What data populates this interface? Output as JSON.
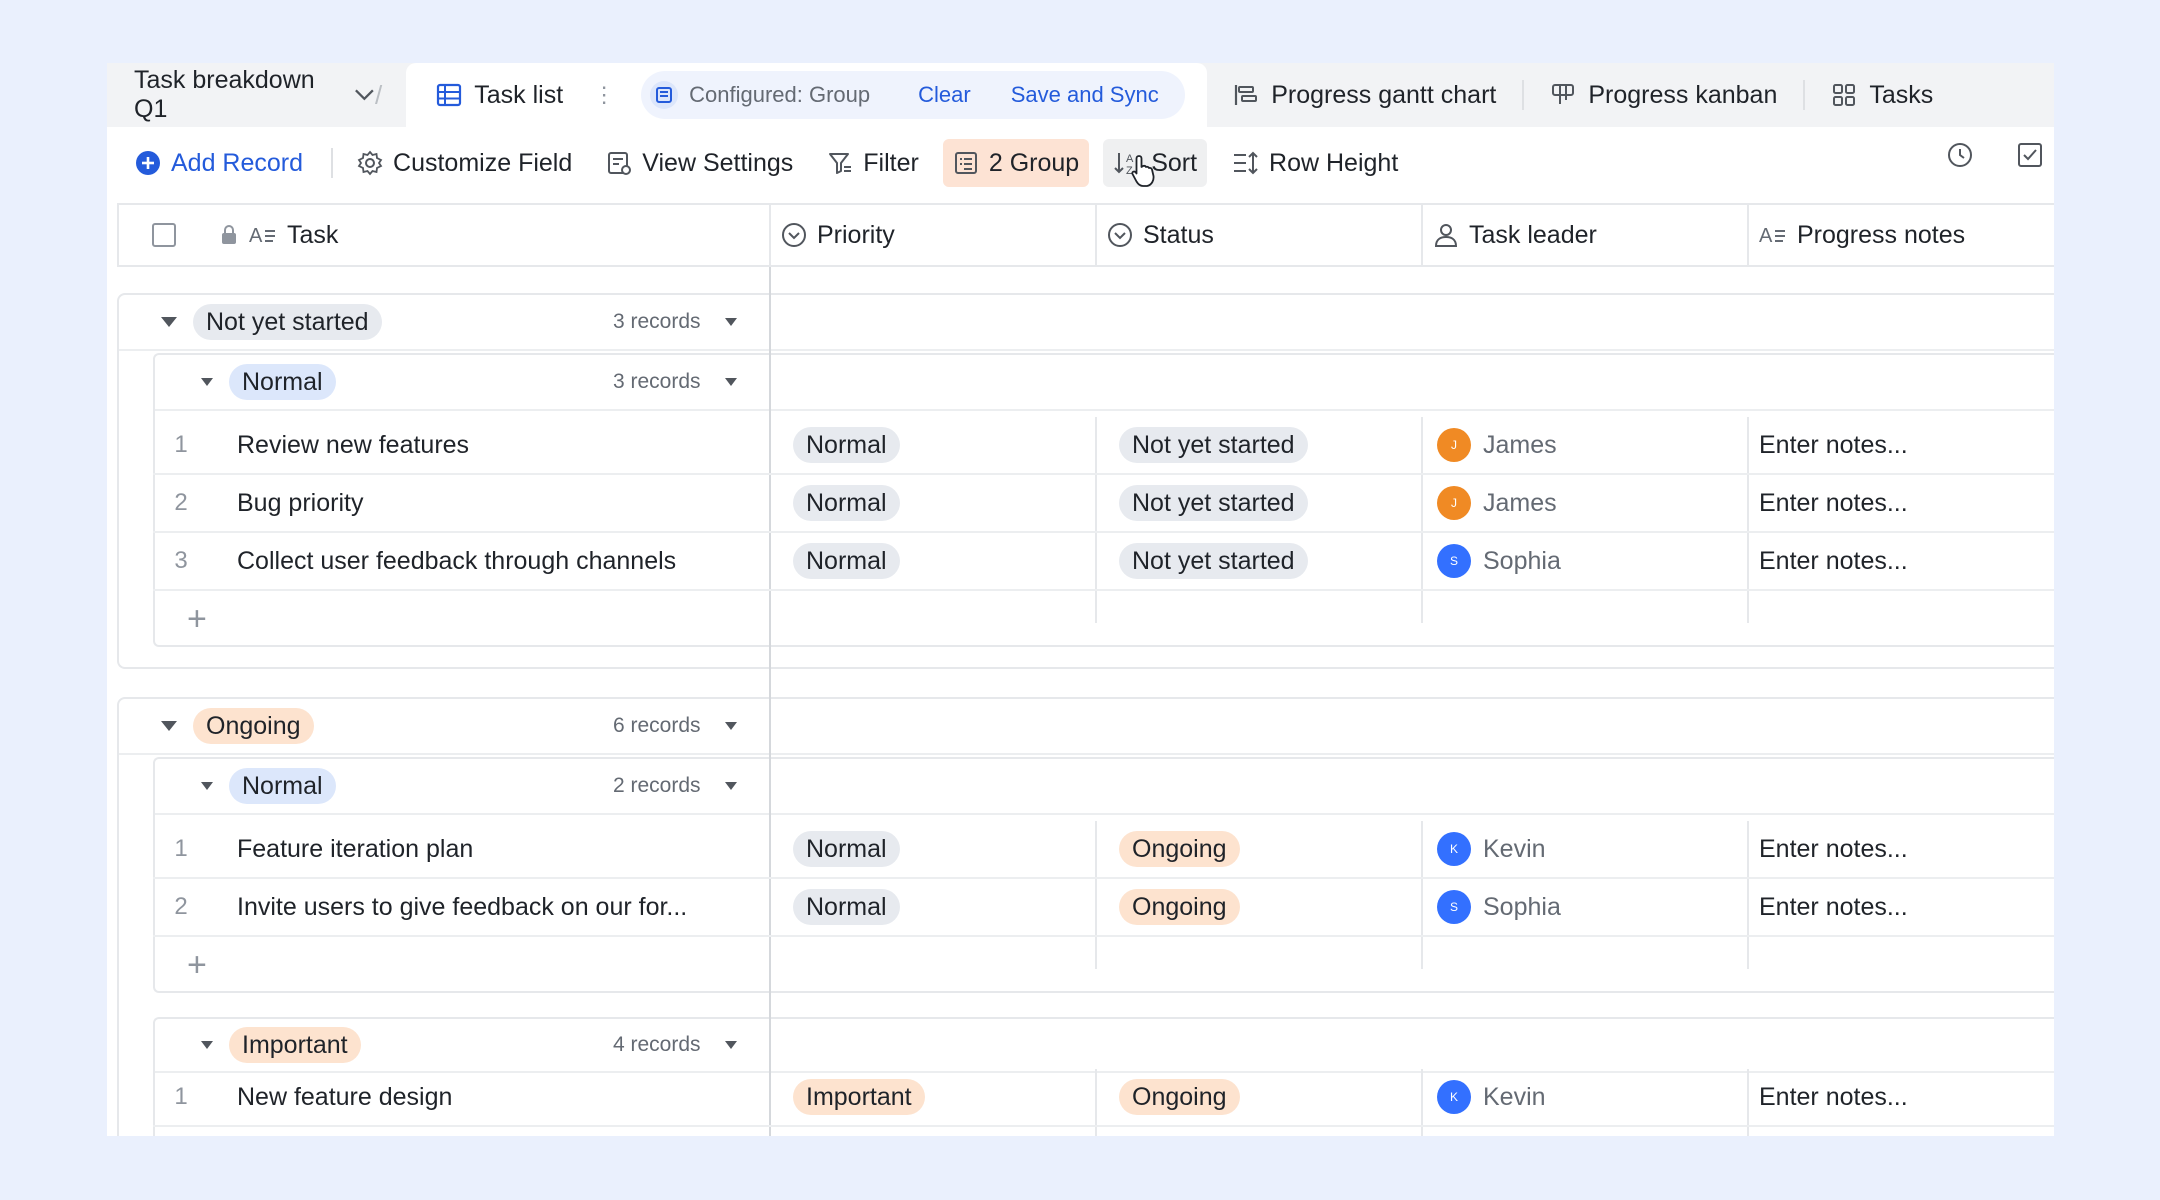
{
  "tabs": {
    "title": "Task breakdown Q1",
    "active_tab": "Task list",
    "configured": "Configured: Group",
    "clear": "Clear",
    "save_sync": "Save and Sync",
    "gantt": "Progress gantt chart",
    "kanban": "Progress kanban",
    "tasks": "Tasks"
  },
  "toolbar": {
    "add_record": "Add Record",
    "customize_field": "Customize Field",
    "view_settings": "View Settings",
    "filter": "Filter",
    "group": "2 Group",
    "sort": "Sort",
    "row_height": "Row Height"
  },
  "columns": {
    "task": "Task",
    "priority": "Priority",
    "status": "Status",
    "task_leader": "Task leader",
    "progress_notes": "Progress notes"
  },
  "colors": {
    "accent": "#245bdb",
    "avatar_james": "#f08a24",
    "avatar_blue": "#3370ff",
    "group_highlight": "#fde3d4"
  },
  "groups": [
    {
      "label": "Not yet started",
      "count": "3 records",
      "subgroups": [
        {
          "label": "Normal",
          "count": "3 records",
          "rows": [
            {
              "num": "1",
              "task": "Review new features",
              "priority": "Normal",
              "status": "Not yet started",
              "leader": "James",
              "initial": "J",
              "notes": "Enter notes..."
            },
            {
              "num": "2",
              "task": "Bug priority",
              "priority": "Normal",
              "status": "Not yet started",
              "leader": "James",
              "initial": "J",
              "notes": "Enter notes..."
            },
            {
              "num": "3",
              "task": "Collect user feedback through channels",
              "priority": "Normal",
              "status": "Not yet started",
              "leader": "Sophia",
              "initial": "S",
              "notes": "Enter notes..."
            }
          ]
        }
      ]
    },
    {
      "label": "Ongoing",
      "count": "6 records",
      "subgroups": [
        {
          "label": "Normal",
          "count": "2 records",
          "rows": [
            {
              "num": "1",
              "task": "Feature iteration plan",
              "priority": "Normal",
              "status": "Ongoing",
              "leader": "Kevin",
              "initial": "K",
              "notes": "Enter notes..."
            },
            {
              "num": "2",
              "task": "Invite users to give feedback on our for...",
              "priority": "Normal",
              "status": "Ongoing",
              "leader": "Sophia",
              "initial": "S",
              "notes": "Enter notes..."
            }
          ]
        },
        {
          "label": "Important",
          "count": "4 records",
          "rows": [
            {
              "num": "1",
              "task": "New feature design",
              "priority": "Important",
              "status": "Ongoing",
              "leader": "Kevin",
              "initial": "K",
              "notes": "Enter notes..."
            }
          ]
        }
      ]
    }
  ]
}
